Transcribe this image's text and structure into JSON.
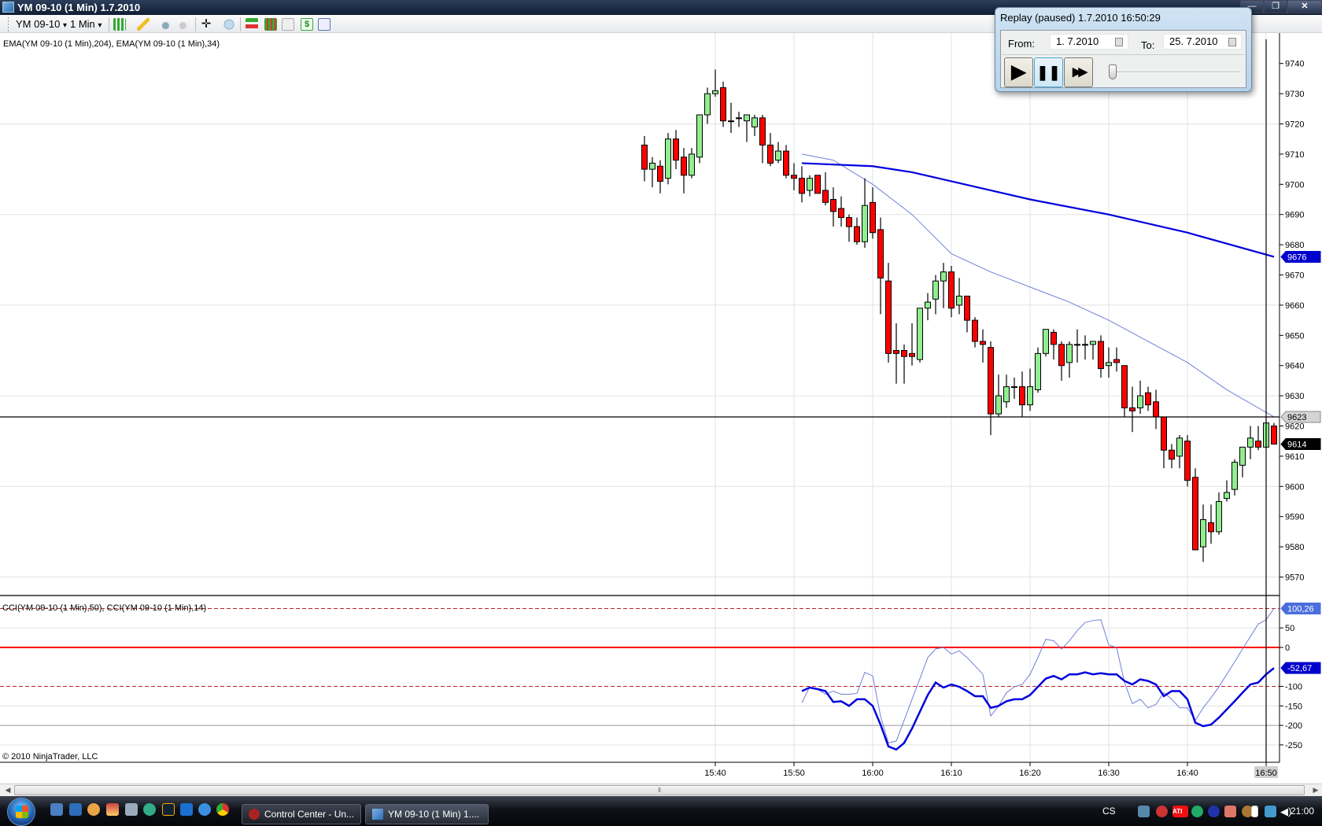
{
  "window": {
    "title": "YM 09-10 (1 Min)  1.7.2010",
    "min": "—",
    "max": "❐",
    "close": "✕"
  },
  "toolbar": {
    "instrument": "YM 09-10",
    "period": "1 Min",
    "dropdown": "▾"
  },
  "indicators": {
    "price_label": "EMA(YM 09-10 (1 Min),204), EMA(YM 09-10 (1 Min),34)",
    "cci_label": "CCI(YM 09-10 (1 Min),50), CCI(YM 09-10 (1 Min),14)"
  },
  "copyright": "© 2010 NinjaTrader, LLC",
  "replay": {
    "title": "Replay (paused) 1.7.2010 16:50:29",
    "from_label": "From:",
    "from_value": "1.  7.2010",
    "to_label": "To:",
    "to_value": "25.  7.2010",
    "play": "▶",
    "pause": "❚❚",
    "fast_forward": "▶▶",
    "speed_position": 0.0
  },
  "colors": {
    "up": "#90ee90",
    "down": "#ff0000",
    "ema204": "#0000dd",
    "ema34": "#7080d8",
    "cci50": "#0000dd",
    "cci14": "#7080d8",
    "zero": "#ff0000"
  },
  "chart_data": {
    "type": "candlestick",
    "price_axis": {
      "ticks": [
        9740,
        9730,
        9720,
        9710,
        9700,
        9690,
        9680,
        9670,
        9660,
        9650,
        9640,
        9630,
        9620,
        9610,
        9600,
        9590,
        9580,
        9570
      ],
      "ylim": [
        9562,
        9747
      ]
    },
    "time_axis": {
      "ticks": [
        "15:40",
        "15:50",
        "16:00",
        "16:10",
        "16:20",
        "16:30",
        "16:40",
        "16:50"
      ],
      "highlight": "16:50"
    },
    "price_markers": [
      {
        "label": "9676",
        "kind": "ema204"
      },
      {
        "label": "9623",
        "kind": "last-line"
      },
      {
        "label": "9614",
        "kind": "last"
      }
    ],
    "last_line": 9623,
    "candles": [
      [
        "15:31",
        9713,
        9716,
        9701,
        9705
      ],
      [
        "15:32",
        9705,
        9709,
        9699,
        9707
      ],
      [
        "15:33",
        9706,
        9708,
        9697,
        9701
      ],
      [
        "15:34",
        9702,
        9717,
        9700,
        9715
      ],
      [
        "15:35",
        9715,
        9718,
        9705,
        9708
      ],
      [
        "15:36",
        9709,
        9712,
        9697,
        9703
      ],
      [
        "15:37",
        9703,
        9712,
        9702,
        9710
      ],
      [
        "15:38",
        9709,
        9723,
        9707,
        9723
      ],
      [
        "15:39",
        9723,
        9732,
        9720,
        9730
      ],
      [
        "15:40",
        9730,
        9738,
        9729,
        9731
      ],
      [
        "15:41",
        9732,
        9734,
        9719,
        9721
      ],
      [
        "15:42",
        9721,
        9727,
        9717,
        9721
      ],
      [
        "15:43",
        9722,
        9724,
        9719,
        9722
      ],
      [
        "15:44",
        9721,
        9723,
        9714,
        9723
      ],
      [
        "15:45",
        9719,
        9723,
        9716,
        9722
      ],
      [
        "15:46",
        9722,
        9723,
        9707,
        9713
      ],
      [
        "15:47",
        9713,
        9717,
        9706,
        9707
      ],
      [
        "15:48",
        9708,
        9714,
        9707,
        9711
      ],
      [
        "15:49",
        9711,
        9713,
        9702,
        9703
      ],
      [
        "15:50",
        9703,
        9707,
        9698,
        9702
      ],
      [
        "15:51",
        9702,
        9706,
        9694,
        9697
      ],
      [
        "15:52",
        9698,
        9703,
        9696,
        9702
      ],
      [
        "15:53",
        9703,
        9703,
        9697,
        9697
      ],
      [
        "15:54",
        9698,
        9704,
        9693,
        9694
      ],
      [
        "15:55",
        9695,
        9699,
        9686,
        9691
      ],
      [
        "15:56",
        9692,
        9696,
        9686,
        9689
      ],
      [
        "15:57",
        9689,
        9690,
        9681,
        9686
      ],
      [
        "15:58",
        9686,
        9689,
        9680,
        9681
      ],
      [
        "15:59",
        9681,
        9702,
        9679,
        9693
      ],
      [
        "16:00",
        9694,
        9699,
        9682,
        9684
      ],
      [
        "16:01",
        9685,
        9689,
        9657,
        9669
      ],
      [
        "16:02",
        9668,
        9674,
        9641,
        9644
      ],
      [
        "16:03",
        9645,
        9654,
        9634,
        9644
      ],
      [
        "16:04",
        9645,
        9647,
        9634,
        9643
      ],
      [
        "16:05",
        9644,
        9654,
        9640,
        9643
      ],
      [
        "16:06",
        9642,
        9659,
        9641,
        9659
      ],
      [
        "16:07",
        9659,
        9664,
        9655,
        9661
      ],
      [
        "16:08",
        9662,
        9670,
        9657,
        9668
      ],
      [
        "16:09",
        9668,
        9674,
        9659,
        9671
      ],
      [
        "16:10",
        9671,
        9673,
        9656,
        9659
      ],
      [
        "16:11",
        9660,
        9669,
        9657,
        9663
      ],
      [
        "16:12",
        9663,
        9663,
        9651,
        9655
      ],
      [
        "16:13",
        9655,
        9656,
        9646,
        9648
      ],
      [
        "16:14",
        9648,
        9652,
        9641,
        9647
      ],
      [
        "16:15",
        9646,
        9648,
        9617,
        9624
      ],
      [
        "16:16",
        9624,
        9637,
        9623,
        9630
      ],
      [
        "16:17",
        9628,
        9637,
        9626,
        9633
      ],
      [
        "16:18",
        9633,
        9636,
        9629,
        9633
      ],
      [
        "16:19",
        9633,
        9638,
        9623,
        9627
      ],
      [
        "16:20",
        9627,
        9639,
        9625,
        9633
      ],
      [
        "16:21",
        9632,
        9646,
        9631,
        9644
      ],
      [
        "16:22",
        9644,
        9652,
        9643,
        9652
      ],
      [
        "16:23",
        9651,
        9652,
        9642,
        9647
      ],
      [
        "16:24",
        9647,
        9648,
        9635,
        9640
      ],
      [
        "16:25",
        9641,
        9648,
        9636,
        9647
      ],
      [
        "16:26",
        9647,
        9652,
        9641,
        9647
      ],
      [
        "16:27",
        9647,
        9650,
        9642,
        9647
      ],
      [
        "16:28",
        9647,
        9648,
        9642,
        9648
      ],
      [
        "16:29",
        9648,
        9650,
        9636,
        9639
      ],
      [
        "16:30",
        9640,
        9646,
        9636,
        9641
      ],
      [
        "16:31",
        9642,
        9646,
        9638,
        9641
      ],
      [
        "16:32",
        9640,
        9640,
        9623,
        9626
      ],
      [
        "16:33",
        9626,
        9633,
        9618,
        9625
      ],
      [
        "16:34",
        9626,
        9635,
        9624,
        9630
      ],
      [
        "16:35",
        9631,
        9633,
        9625,
        9627
      ],
      [
        "16:36",
        9628,
        9632,
        9619,
        9623
      ],
      [
        "16:37",
        9623,
        9623,
        9606,
        9612
      ],
      [
        "16:38",
        9612,
        9614,
        9606,
        9609
      ],
      [
        "16:39",
        9610,
        9617,
        9606,
        9616
      ],
      [
        "16:40",
        9615,
        9617,
        9600,
        9602
      ],
      [
        "16:41",
        9603,
        9606,
        9579,
        9579
      ],
      [
        "16:42",
        9580,
        9594,
        9575,
        9589
      ],
      [
        "16:43",
        9588,
        9594,
        9581,
        9585
      ],
      [
        "16:44",
        9585,
        9598,
        9584,
        9595
      ],
      [
        "16:45",
        9596,
        9602,
        9595,
        9598
      ],
      [
        "16:46",
        9599,
        9609,
        9597,
        9608
      ],
      [
        "16:47",
        9607,
        9613,
        9603,
        9613
      ],
      [
        "16:48",
        9613,
        9620,
        9609,
        9616
      ],
      [
        "16:49",
        9615,
        9620,
        9612,
        9613
      ],
      [
        "16:50",
        9613,
        9621,
        9613,
        9621
      ],
      [
        "16:51",
        9620,
        9621,
        9614,
        9614
      ]
    ],
    "ema204": [
      [
        "15:51",
        9707
      ],
      [
        "16:00",
        9706
      ],
      [
        "16:05",
        9704
      ],
      [
        "16:10",
        9701
      ],
      [
        "16:20",
        9695
      ],
      [
        "16:30",
        9690
      ],
      [
        "16:40",
        9684
      ],
      [
        "16:51",
        9676
      ]
    ],
    "ema34": [
      [
        "15:51",
        9710
      ],
      [
        "15:55",
        9708
      ],
      [
        "16:00",
        9700
      ],
      [
        "16:05",
        9690
      ],
      [
        "16:10",
        9677
      ],
      [
        "16:15",
        9671
      ],
      [
        "16:20",
        9666
      ],
      [
        "16:25",
        9661
      ],
      [
        "16:30",
        9655
      ],
      [
        "16:35",
        9648
      ],
      [
        "16:40",
        9641
      ],
      [
        "16:45",
        9632
      ],
      [
        "16:51",
        9623
      ]
    ],
    "cci": {
      "ticks": [
        50,
        0,
        -100,
        -150,
        -200,
        -250
      ],
      "levels": {
        "upper": 100,
        "zero": 0,
        "lower": -100,
        "grid": -200
      },
      "markers": [
        {
          "label": "100,26",
          "kind": "cci14"
        },
        {
          "label": "-52,67",
          "kind": "cci50"
        }
      ],
      "start": "15:51",
      "cci50": [
        -112,
        -103,
        -107,
        -112,
        -140,
        -138,
        -150,
        -133,
        -133,
        -150,
        -198,
        -254,
        -262,
        -245,
        -208,
        -165,
        -122,
        -90,
        -103,
        -95,
        -101,
        -112,
        -125,
        -125,
        -155,
        -150,
        -138,
        -133,
        -133,
        -122,
        -101,
        -80,
        -73,
        -82,
        -69,
        -69,
        -64,
        -69,
        -66,
        -69,
        -69,
        -86,
        -95,
        -82,
        -86,
        -95,
        -125,
        -112,
        -112,
        -133,
        -193,
        -202,
        -198,
        -180,
        -159,
        -138,
        -116,
        -95,
        -90,
        -69,
        -53
      ],
      "cci14": [
        -142,
        -101,
        -107,
        -120,
        -112,
        -120,
        -120,
        -118,
        -64,
        -73,
        -176,
        -245,
        -240,
        -187,
        -133,
        -80,
        -26,
        -4,
        0,
        -17,
        -9,
        -26,
        -47,
        -69,
        -176,
        -150,
        -116,
        -101,
        -95,
        -69,
        -26,
        21,
        17,
        -4,
        17,
        43,
        64,
        69,
        71,
        6,
        0,
        -90,
        -144,
        -133,
        -155,
        -146,
        -116,
        -133,
        -155,
        -155,
        -187,
        -155,
        -129,
        -101,
        -69,
        -37,
        -4,
        28,
        60,
        71,
        100
      ]
    }
  },
  "taskbar": {
    "tasks": [
      {
        "label": "Control Center - Un..."
      },
      {
        "label": "YM 09-10 (1 Min)  1...."
      }
    ],
    "lang": "CS",
    "clock": "21:00",
    "scroll_grip": "⦀",
    "scroll_left": "◀",
    "scroll_right": "▶"
  }
}
